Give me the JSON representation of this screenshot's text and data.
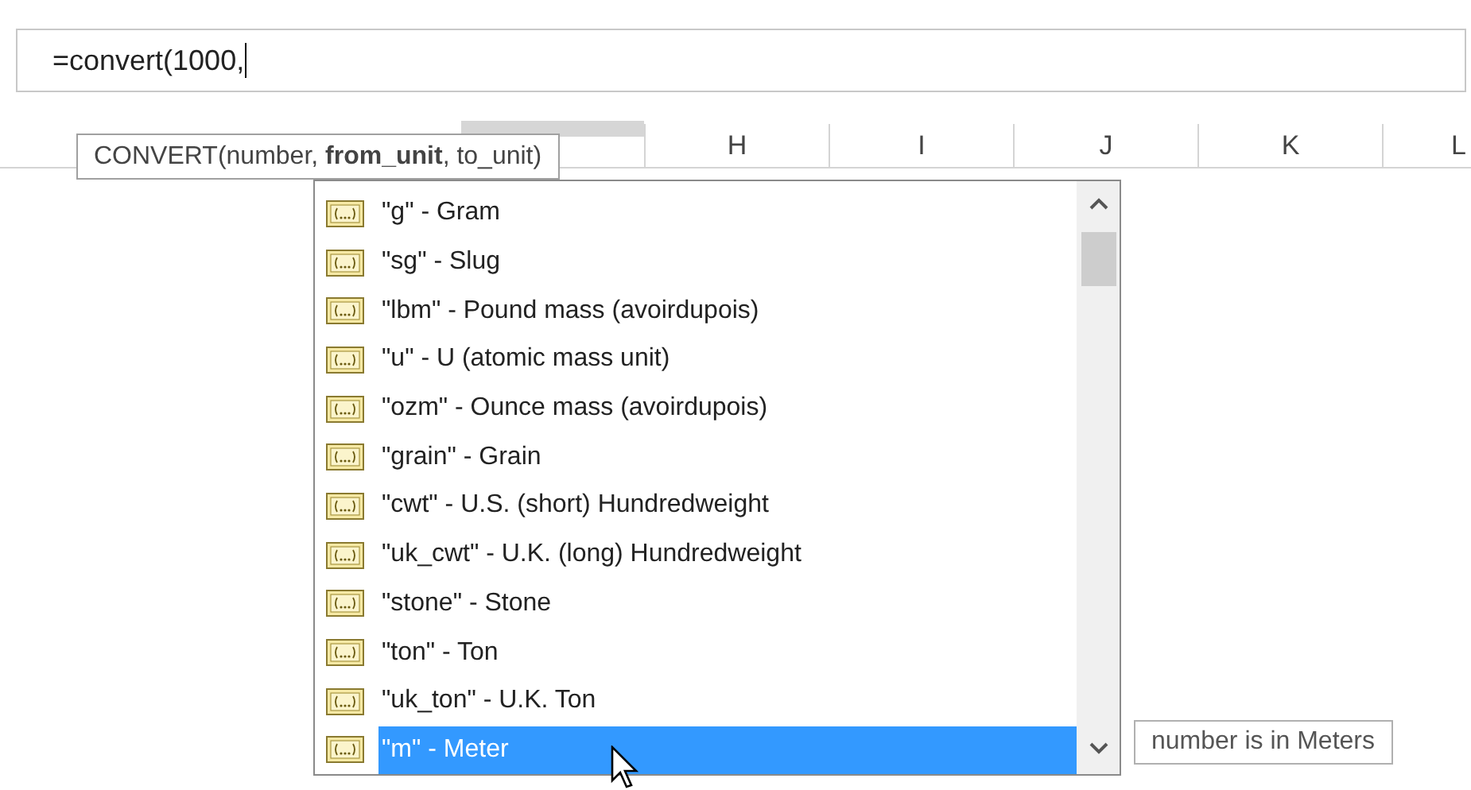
{
  "formula_bar": {
    "value": "=convert(1000,"
  },
  "column_headers": [
    {
      "label": "H"
    },
    {
      "label": "I"
    },
    {
      "label": "J"
    },
    {
      "label": "K"
    },
    {
      "label": "L"
    }
  ],
  "function_tooltip": {
    "text": "CONVERT(number, **from_unit**, to_unit)"
  },
  "autocomplete": {
    "items": [
      {
        "label": "\"g\" - Gram",
        "selected": false
      },
      {
        "label": "\"sg\" - Slug",
        "selected": false
      },
      {
        "label": "\"lbm\" - Pound mass (avoirdupois)",
        "selected": false
      },
      {
        "label": "\"u\" - U (atomic mass unit)",
        "selected": false
      },
      {
        "label": "\"ozm\" - Ounce mass (avoirdupois)",
        "selected": false
      },
      {
        "label": "\"grain\" - Grain",
        "selected": false
      },
      {
        "label": "\"cwt\" - U.S. (short) Hundredweight",
        "selected": false
      },
      {
        "label": "\"uk_cwt\" - U.K. (long) Hundredweight",
        "selected": false
      },
      {
        "label": "\"stone\" - Stone",
        "selected": false
      },
      {
        "label": "\"ton\" - Ton",
        "selected": false
      },
      {
        "label": "\"uk_ton\" - U.K. Ton",
        "selected": false
      },
      {
        "label": "\"m\" - Meter",
        "selected": true
      }
    ]
  },
  "item_tooltip": {
    "text": "number is in Meters"
  }
}
